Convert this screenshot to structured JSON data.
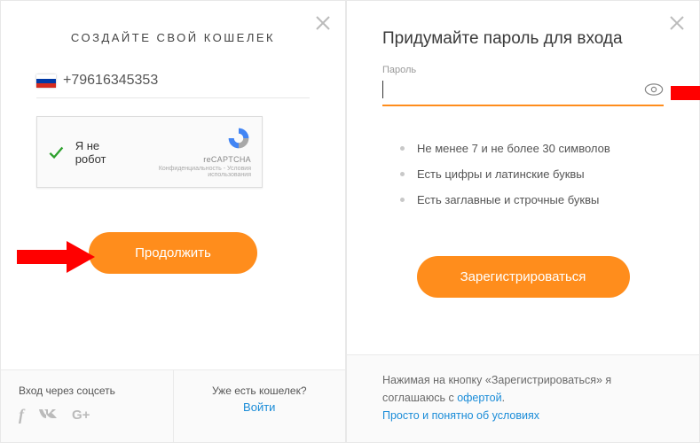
{
  "left": {
    "title": "Создайте свой кошелек",
    "flag_colors": [
      "#ffffff",
      "#0039a6",
      "#d52b1e"
    ],
    "phone": "+79616345353",
    "captcha": {
      "label": "Я не робот",
      "brand": "reCAPTCHA",
      "terms": "Конфиденциальность - Условия использования"
    },
    "button": "Продолжить",
    "footer": {
      "social_label": "Вход через соцсеть",
      "existing_label": "Уже есть кошелек?",
      "login": "Войти"
    }
  },
  "right": {
    "title": "Придумайте пароль для входа",
    "password_label": "Пароль",
    "rules": [
      "Не менее 7 и не более 30 символов",
      "Есть цифры и латинские буквы",
      "Есть заглавные и строчные буквы"
    ],
    "button": "Зарегистрироваться",
    "footer": {
      "text1_a": "Нажимая на кнопку «Зарегистрироваться» я соглашаюсь с ",
      "offer": "офертой",
      "period": ".",
      "text2": "Просто и понятно об условиях"
    }
  }
}
